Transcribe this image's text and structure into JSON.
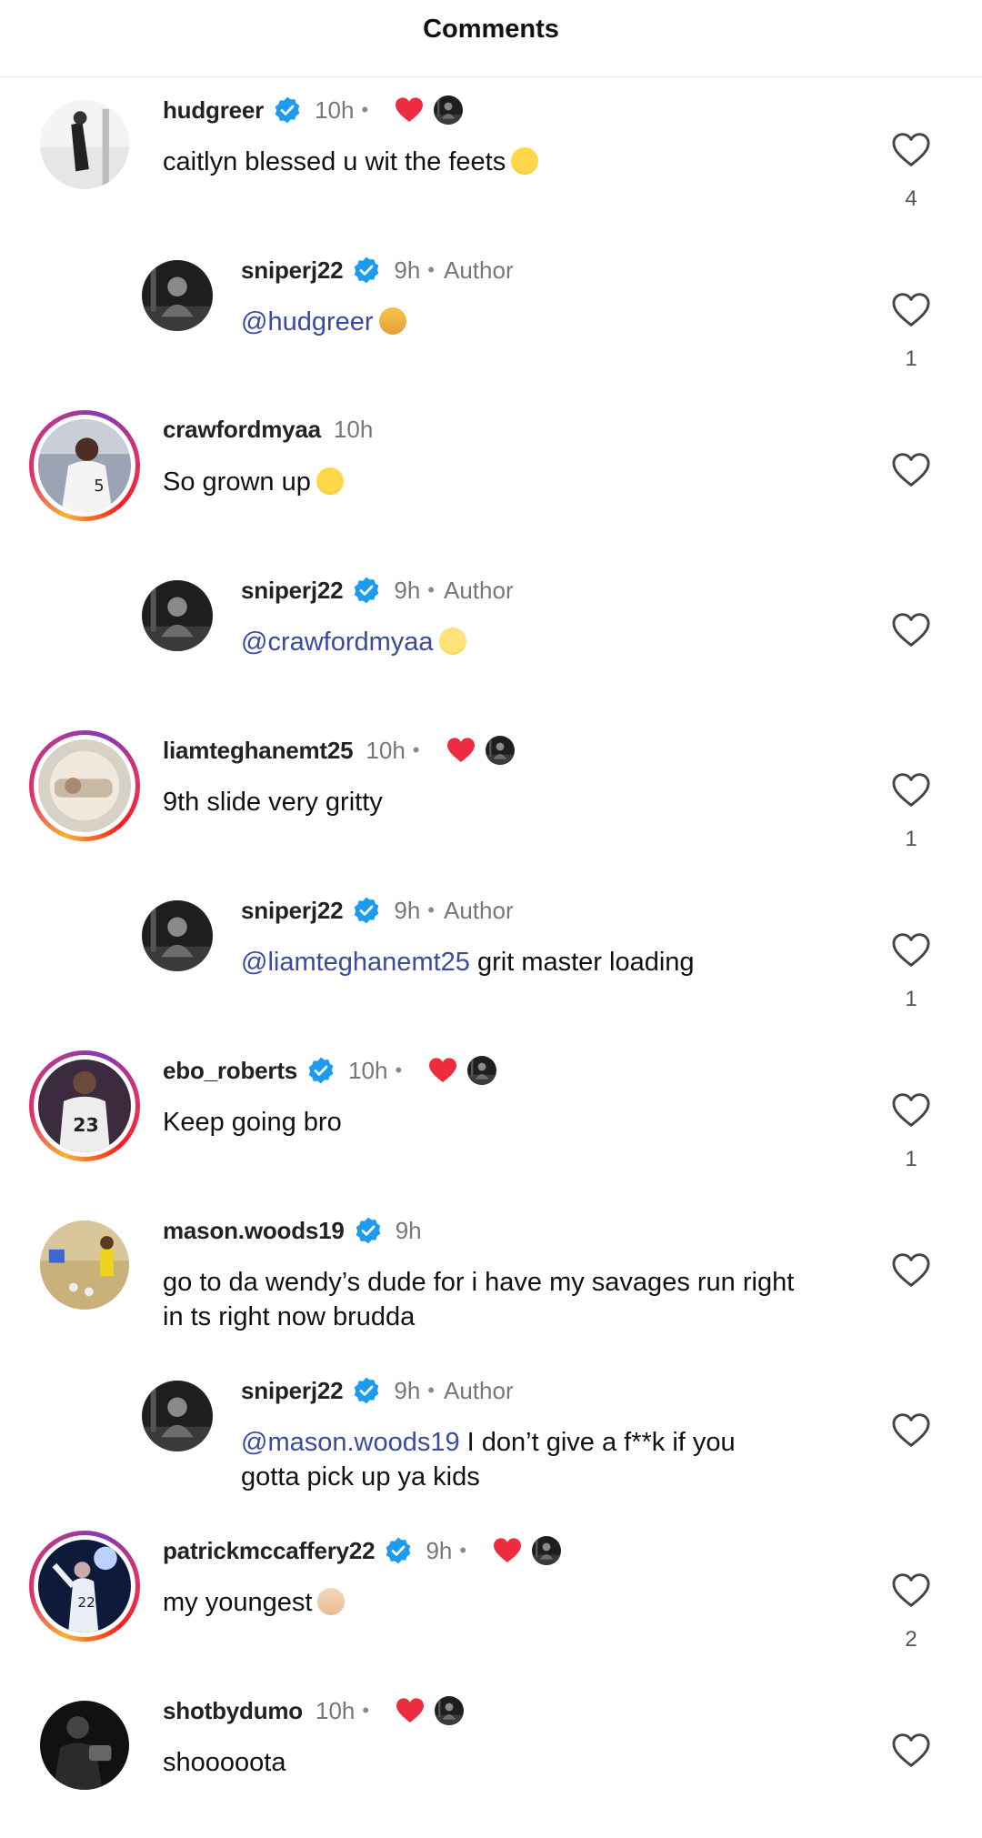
{
  "header": {
    "title": "Comments"
  },
  "colors": {
    "mention": "#3a4aa0",
    "verified": "#1d9bf0",
    "heart_red": "#ed2d3f",
    "ring": [
      "#f9b233",
      "#e1306c",
      "#833ab4"
    ]
  },
  "comments": [
    {
      "username": "hudgreer",
      "verified": true,
      "time": "10h",
      "author_liked": true,
      "text": "caitlyn blessed u wit the feets",
      "emoji": "joy-emoji",
      "likes": "4"
    },
    {
      "username": "sniperj22",
      "verified": true,
      "time": "9h",
      "author": "Author",
      "mention": "@hudgreer",
      "text": "",
      "emoji": "folded-hands-emoji",
      "likes": "1"
    },
    {
      "username": "crawfordmyaa",
      "verified": false,
      "time": "10h",
      "text": "So grown up",
      "emoji": "crying-emoji",
      "likes": ""
    },
    {
      "username": "sniperj22",
      "verified": true,
      "time": "9h",
      "author": "Author",
      "mention": "@crawfordmyaa",
      "text": "",
      "emoji": "face-peeking-emoji",
      "likes": ""
    },
    {
      "username": "liamteghanemt25",
      "verified": false,
      "time": "10h",
      "author_liked": true,
      "text": "9th slide very gritty",
      "likes": "1"
    },
    {
      "username": "sniperj22",
      "verified": true,
      "time": "9h",
      "author": "Author",
      "mention": "@liamteghanemt25",
      "text": " grit master loading",
      "likes": "1"
    },
    {
      "username": "ebo_roberts",
      "verified": true,
      "time": "10h",
      "author_liked": true,
      "text": "Keep going bro",
      "likes": "1"
    },
    {
      "username": "mason.woods19",
      "verified": true,
      "time": "9h",
      "text_line1": "go to da wendy’s dude for i have my savages run right",
      "text_line2": "in ts right now brudda",
      "likes": ""
    },
    {
      "username": "sniperj22",
      "verified": true,
      "time": "9h",
      "author": "Author",
      "mention": "@mason.woods19",
      "text_line1": " I don’t give a f**k if you",
      "text_line2": "gotta pick up ya kids",
      "likes": ""
    },
    {
      "username": "patrickmccaffery22",
      "verified": true,
      "time": "9h",
      "author_liked": true,
      "text": "my youngest",
      "emoji": "crossed-fingers-emoji",
      "likes": "2"
    },
    {
      "username": "shotbydumo",
      "verified": false,
      "time": "10h",
      "author_liked": true,
      "text": "shooooota",
      "likes": ""
    }
  ]
}
